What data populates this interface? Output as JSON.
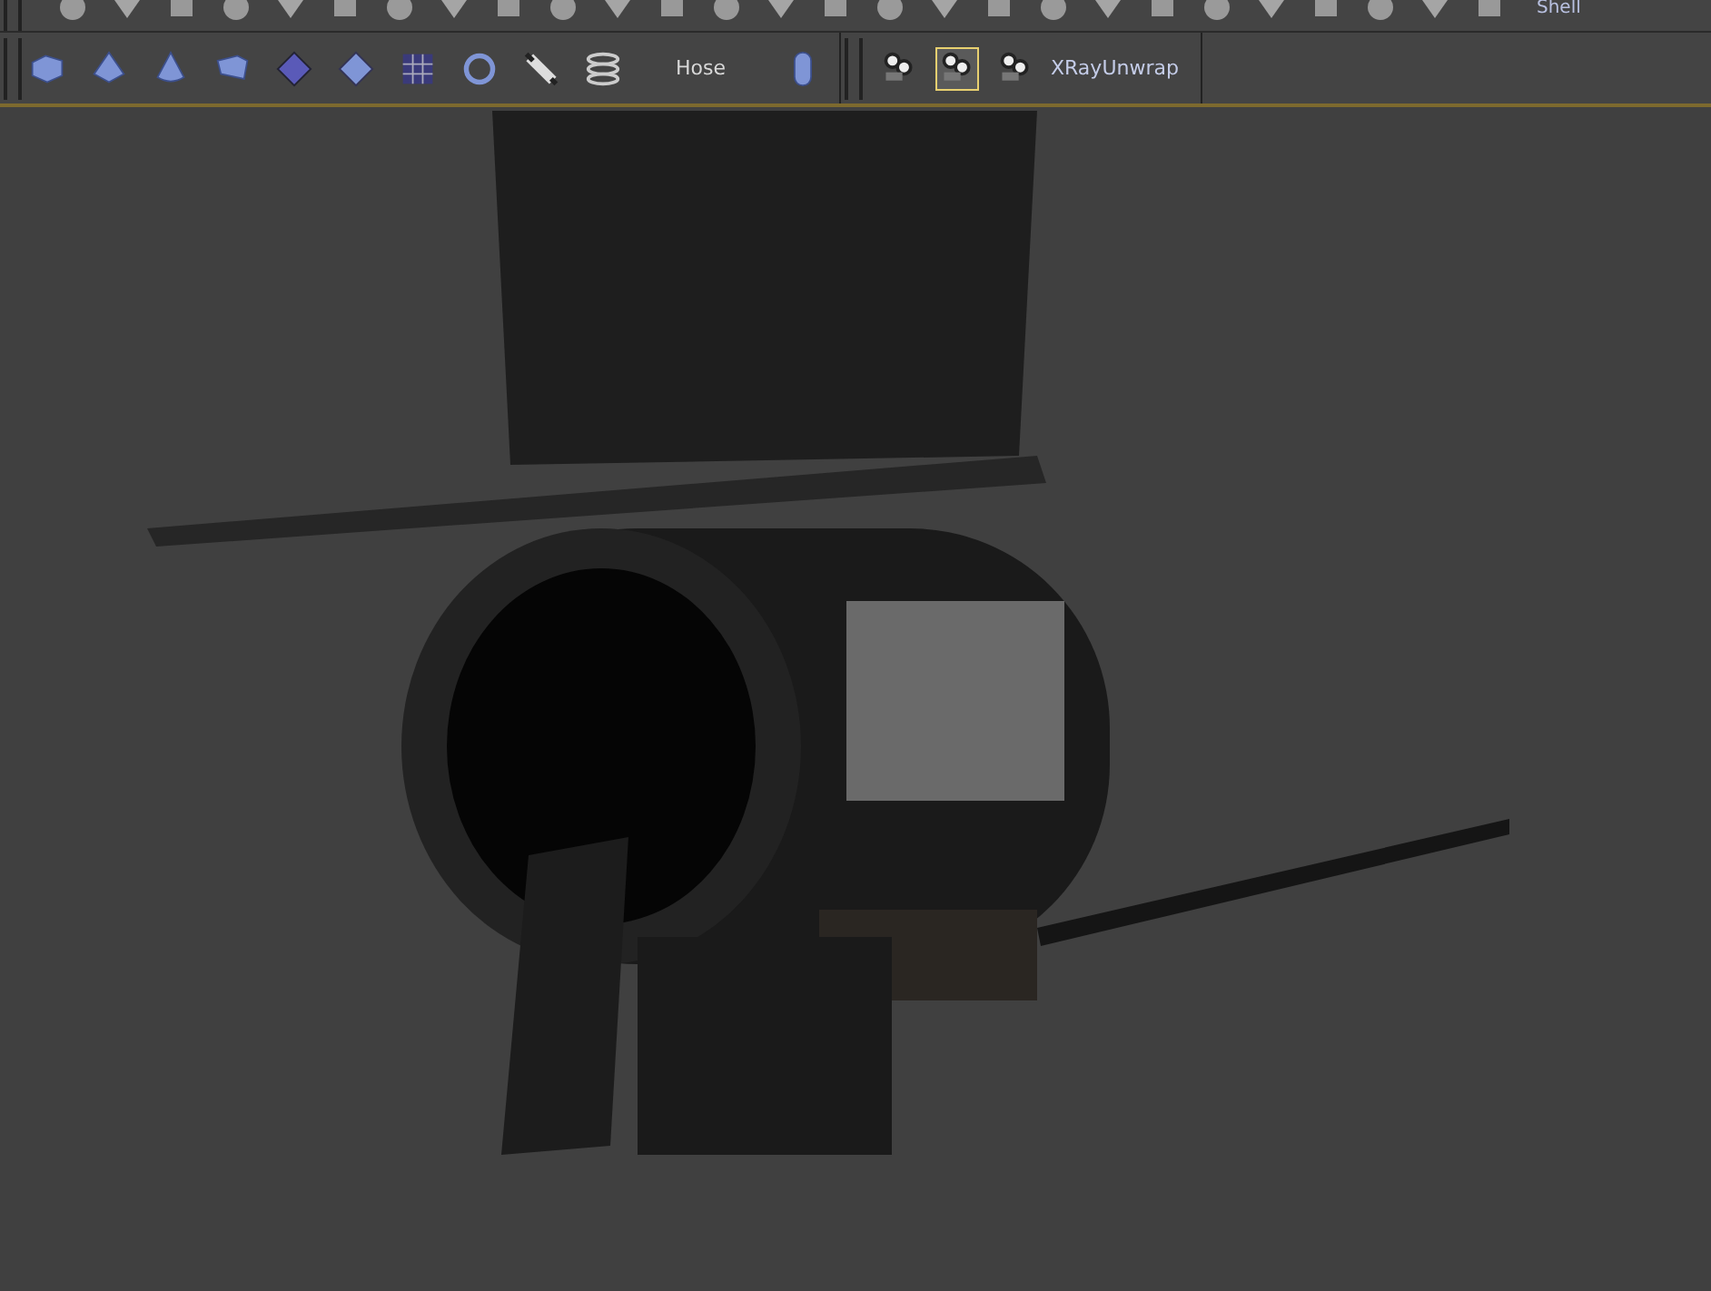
{
  "top_toolbar": {
    "label": "Shell"
  },
  "primitives_toolbar": {
    "label": "Hose"
  },
  "xray_toolbar": {
    "buttons": [
      {
        "selected": false
      },
      {
        "selected": true
      },
      {
        "selected": false
      }
    ],
    "label": "XRayUnwrap"
  }
}
